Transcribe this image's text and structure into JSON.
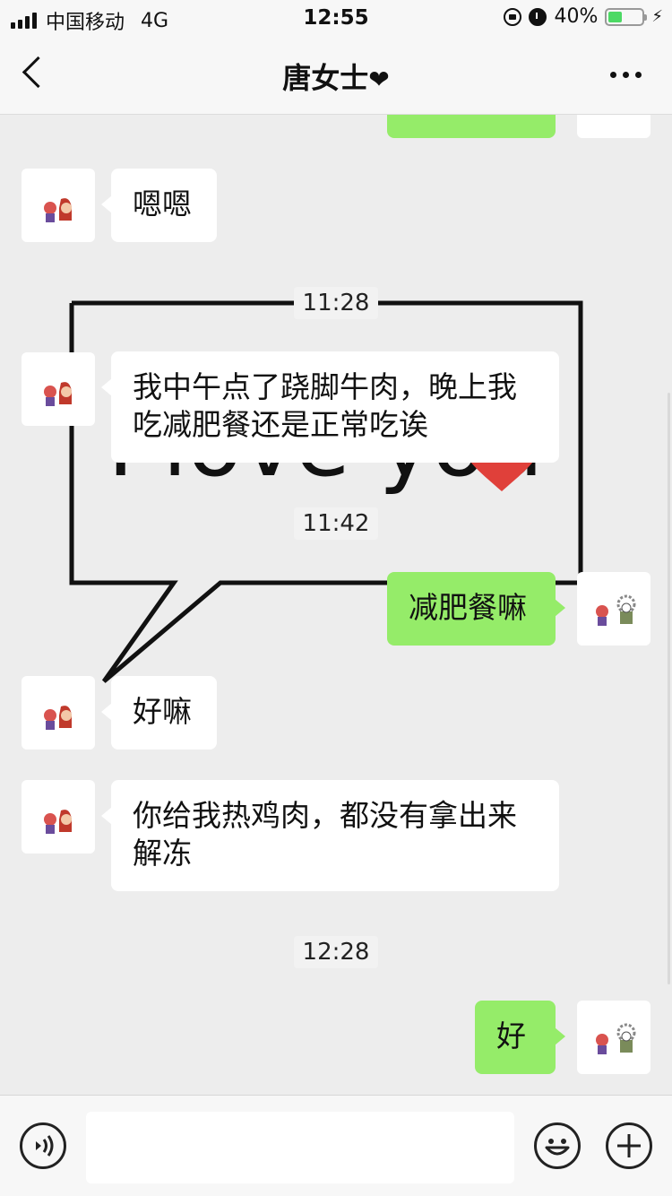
{
  "status_bar": {
    "carrier": "中国移动",
    "network": "4G",
    "time": "12:55",
    "battery": "40%",
    "battery_level": 0.4,
    "icons": [
      "signal-icon",
      "orientation-lock-icon",
      "alarm-icon",
      "battery-icon",
      "charging-icon"
    ]
  },
  "header": {
    "title": "唐女士",
    "title_suffix": "❤",
    "back_icon": "chevron-left-icon",
    "more_icon": "more-dots-icon"
  },
  "messages": [
    {
      "type": "outgoing",
      "text": ""
    },
    {
      "type": "incoming",
      "text": "嗯嗯"
    },
    {
      "type": "time",
      "text": "11:28"
    },
    {
      "type": "incoming",
      "text": "我中午点了跷脚牛肉，晚上我吃减肥餐还是正常吃诶"
    },
    {
      "type": "time",
      "text": "11:42"
    },
    {
      "type": "outgoing",
      "text": "减肥餐嘛"
    },
    {
      "type": "incoming",
      "text": "好嘛"
    },
    {
      "type": "incoming",
      "text": "你给我热鸡肉，都没有拿出来解冻"
    },
    {
      "type": "time",
      "text": "12:28"
    },
    {
      "type": "outgoing",
      "text": "好"
    }
  ],
  "background": {
    "text": "I love you"
  },
  "input_bar": {
    "placeholder": "",
    "icons": [
      "voice-icon",
      "emoji-icon",
      "plus-icon"
    ]
  },
  "colors": {
    "outgoing_bubble": "#95ec69",
    "incoming_bubble": "#ffffff",
    "chat_background": "#ededed",
    "battery_fill": "#4cd964",
    "heart_red": "#e0403a"
  }
}
